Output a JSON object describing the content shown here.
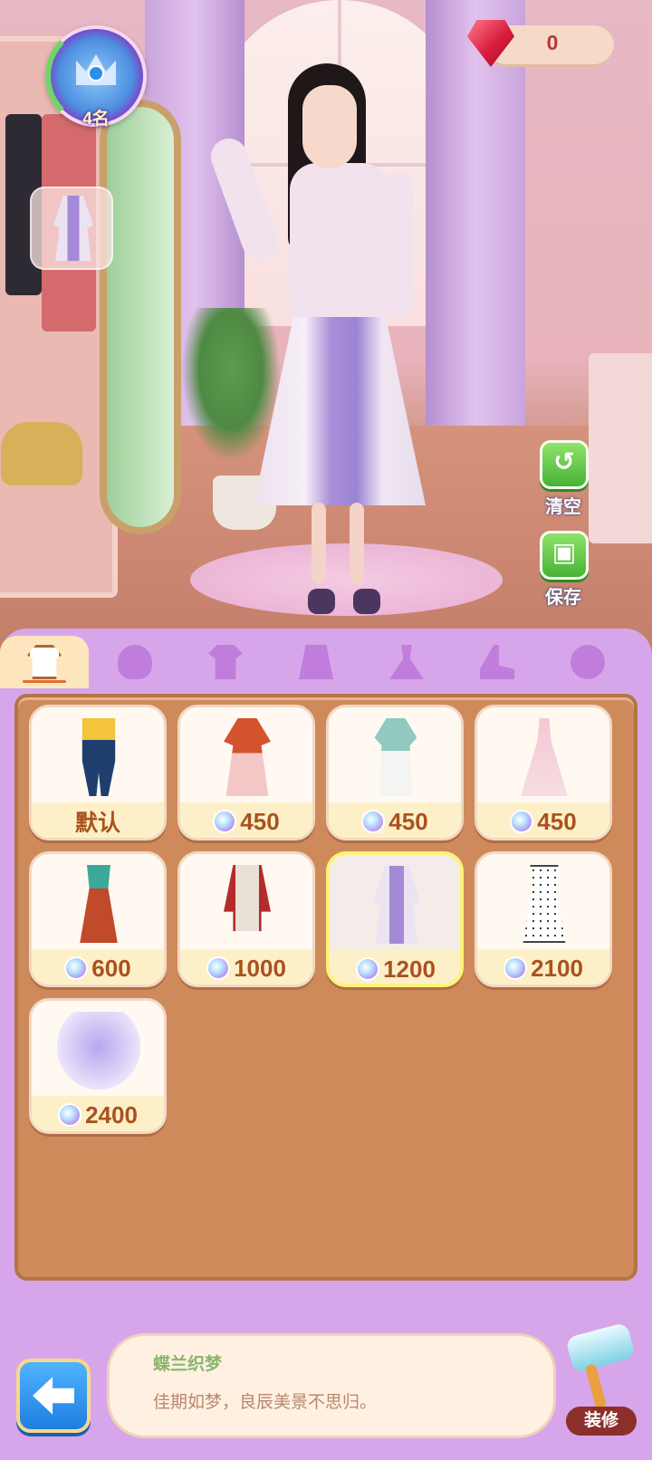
{
  "hud": {
    "rank_text": "4名",
    "gem_count": "0"
  },
  "side_buttons": {
    "clear_label": "清空",
    "save_label": "保存"
  },
  "tabs": [
    {
      "icon": "outfit-set-icon",
      "active": true
    },
    {
      "icon": "hair-icon",
      "active": false
    },
    {
      "icon": "top-icon",
      "active": false
    },
    {
      "icon": "skirt-icon",
      "active": false
    },
    {
      "icon": "dress-icon",
      "active": false
    },
    {
      "icon": "high-heel-icon",
      "active": false
    },
    {
      "icon": "accessory-icon",
      "active": false
    }
  ],
  "items": [
    {
      "label": "默认",
      "price": null,
      "selected": false
    },
    {
      "label": null,
      "price": "450",
      "selected": false
    },
    {
      "label": null,
      "price": "450",
      "selected": false
    },
    {
      "label": null,
      "price": "450",
      "selected": false
    },
    {
      "label": null,
      "price": "600",
      "selected": false
    },
    {
      "label": null,
      "price": "1000",
      "selected": false
    },
    {
      "label": null,
      "price": "1200",
      "selected": true
    },
    {
      "label": null,
      "price": "2100",
      "selected": false
    },
    {
      "label": null,
      "price": "2400",
      "selected": false
    }
  ],
  "description": {
    "title": "蝶兰织梦",
    "text": "佳期如梦，良辰美景不思归。"
  },
  "decorate_label": "装修",
  "colors": {
    "panel": "#d7a6ea",
    "items_background": "#cf8a5c",
    "price_text": "#a9521e",
    "selected_border": "#fff27a",
    "action_green": "#46b335",
    "back_blue": "#1e7fe0"
  }
}
